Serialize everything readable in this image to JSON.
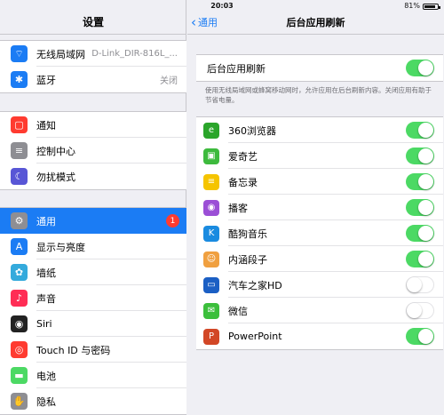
{
  "status_bar": {
    "device": "iPad",
    "time": "20:03",
    "battery": "81%"
  },
  "left": {
    "title": "设置",
    "group1": [
      {
        "icon": "wifi-icon",
        "color": "#1b7cf4",
        "glyph": "⌔",
        "label": "无线局域网",
        "value": "D-Link_DIR-816L_..."
      },
      {
        "icon": "bluetooth-icon",
        "color": "#1b7cf4",
        "glyph": "✱",
        "label": "蓝牙",
        "value": "关闭"
      }
    ],
    "group2": [
      {
        "icon": "notifications-icon",
        "color": "#ff3b30",
        "glyph": "▢",
        "label": "通知"
      },
      {
        "icon": "control-center-icon",
        "color": "#8e8e93",
        "glyph": "≡",
        "label": "控制中心"
      },
      {
        "icon": "do-not-disturb-icon",
        "color": "#5856d6",
        "glyph": "☾",
        "label": "勿扰模式"
      }
    ],
    "group3": [
      {
        "icon": "general-gear-icon",
        "color": "#8e8e93",
        "glyph": "⚙",
        "label": "通用",
        "badge": "1",
        "selected": true
      },
      {
        "icon": "display-brightness-icon",
        "color": "#1b7cf4",
        "glyph": "A",
        "label": "显示与亮度"
      },
      {
        "icon": "wallpaper-icon",
        "color": "#34aadc",
        "glyph": "✿",
        "label": "墙纸"
      },
      {
        "icon": "sounds-icon",
        "color": "#ff2d55",
        "glyph": "♪",
        "label": "声音"
      },
      {
        "icon": "siri-icon",
        "color": "#222222",
        "glyph": "◉",
        "label": "Siri"
      },
      {
        "icon": "touch-id-icon",
        "color": "#ff3b30",
        "glyph": "◎",
        "label": "Touch ID 与密码"
      },
      {
        "icon": "battery-icon",
        "color": "#4cd964",
        "glyph": "▬",
        "label": "电池"
      },
      {
        "icon": "privacy-hand-icon",
        "color": "#8e8e93",
        "glyph": "✋",
        "label": "隐私"
      }
    ]
  },
  "right": {
    "back_label": "通用",
    "title": "后台应用刷新",
    "master": {
      "label": "后台应用刷新",
      "on": true
    },
    "description": "使用无线局域网或蜂窝移动网时，允许应用在后台刷新内容。关闭应用有助于节省电量。",
    "apps": [
      {
        "icon": "browser-360-icon",
        "color": "#2aa52a",
        "glyph": "e",
        "label": "360浏览器",
        "on": true
      },
      {
        "icon": "iqiyi-icon",
        "color": "#3dba3d",
        "glyph": "▣",
        "label": "爱奇艺",
        "on": true
      },
      {
        "icon": "notes-icon",
        "color": "#f5c400",
        "glyph": "≡",
        "label": "备忘录",
        "on": true
      },
      {
        "icon": "podcasts-icon",
        "color": "#9b4fd6",
        "glyph": "◉",
        "label": "播客",
        "on": true
      },
      {
        "icon": "kugou-music-icon",
        "color": "#1a8be0",
        "glyph": "K",
        "label": "酷狗音乐",
        "on": true
      },
      {
        "icon": "neihan-duanzi-icon",
        "color": "#f0a040",
        "glyph": "☺",
        "label": "内涵段子",
        "on": true
      },
      {
        "icon": "autohome-icon",
        "color": "#1b5fc4",
        "glyph": "▭",
        "label": "汽车之家HD",
        "on": false
      },
      {
        "icon": "wechat-icon",
        "color": "#3cbf3c",
        "glyph": "✉",
        "label": "微信",
        "on": false
      },
      {
        "icon": "powerpoint-icon",
        "color": "#d24726",
        "glyph": "P",
        "label": "PowerPoint",
        "on": true
      }
    ]
  }
}
